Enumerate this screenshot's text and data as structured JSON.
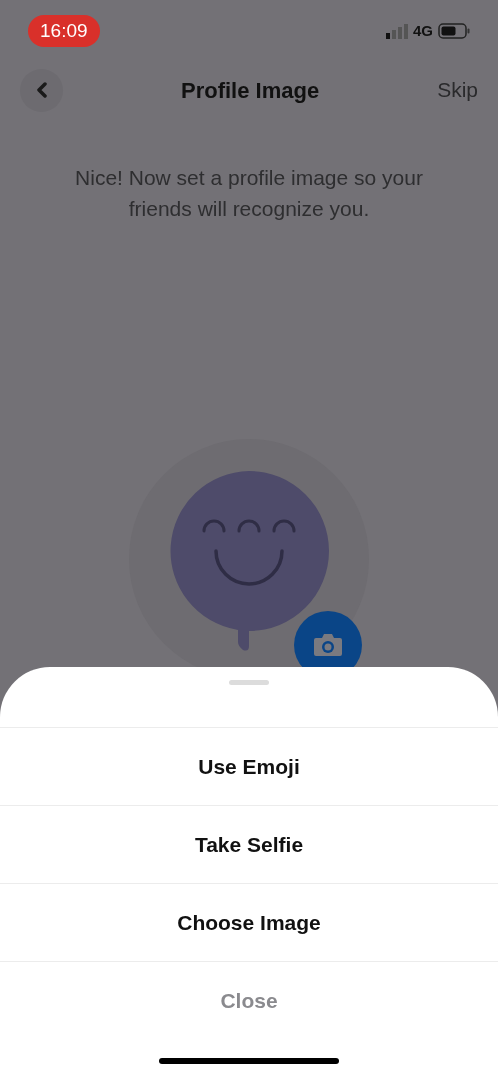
{
  "status_bar": {
    "time": "16:09",
    "network": "4G"
  },
  "header": {
    "title": "Profile Image",
    "action": "Skip"
  },
  "message": "Nice! Now set a profile image so your friends will recognize you.",
  "sheet": {
    "items": [
      {
        "label": "Use Emoji",
        "kind": "action"
      },
      {
        "label": "Take Selfie",
        "kind": "action"
      },
      {
        "label": "Choose Image",
        "kind": "action"
      },
      {
        "label": "Close",
        "kind": "cancel"
      }
    ]
  }
}
